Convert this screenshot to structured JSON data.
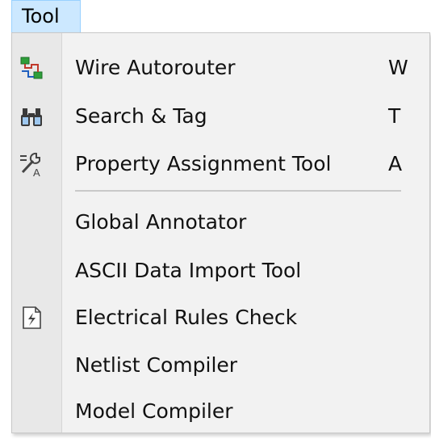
{
  "menubar": {
    "title": "Tool"
  },
  "menu": {
    "items": [
      {
        "label": "Wire Autorouter",
        "shortcut": "W",
        "icon": "wire-autorouter-icon"
      },
      {
        "label": "Search & Tag",
        "shortcut": "T",
        "icon": "binoculars-icon"
      },
      {
        "label": "Property Assignment Tool",
        "shortcut": "A",
        "icon": "property-assignment-icon"
      },
      {
        "label": "Global Annotator",
        "shortcut": "",
        "icon": ""
      },
      {
        "label": "ASCII Data Import Tool",
        "shortcut": "",
        "icon": ""
      },
      {
        "label": "Electrical Rules Check",
        "shortcut": "",
        "icon": "electrical-rules-check-icon"
      },
      {
        "label": "Netlist Compiler",
        "shortcut": "",
        "icon": ""
      },
      {
        "label": "Model Compiler",
        "shortcut": "",
        "icon": ""
      }
    ]
  },
  "colors": {
    "menubar_highlight": "#cce8ff",
    "menu_background": "#f2f2f2",
    "gutter_background": "#e8e8e8",
    "icon_green": "#2e9e3a",
    "icon_blue": "#1f5fbf"
  }
}
